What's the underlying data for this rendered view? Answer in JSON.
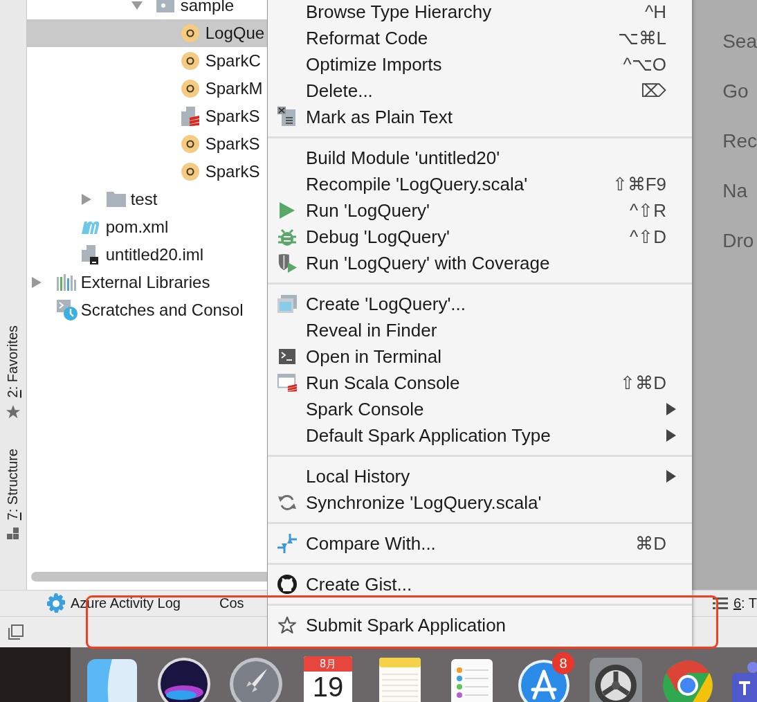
{
  "left_toolbar": [
    {
      "label": "2: Favorites",
      "kind": "favorites"
    },
    {
      "label": "7: Structure",
      "kind": "structure"
    }
  ],
  "project_tree": [
    {
      "children": [
        {
          "children": [
            {
              "children": [
                {
                  "children": [
                    {
                      "label": "sample",
                      "kind": "package",
                      "expanded": true,
                      "selected": false,
                      "children": [
                        {
                          "label": "LogQue",
                          "kind": "class",
                          "selected": true
                        },
                        {
                          "label": "SparkC",
                          "kind": "class",
                          "selected": false
                        },
                        {
                          "label": "SparkM",
                          "kind": "class",
                          "selected": false
                        },
                        {
                          "label": "SparkS",
                          "kind": "scala-script",
                          "selected": false
                        },
                        {
                          "label": "SparkS",
                          "kind": "class",
                          "selected": false
                        },
                        {
                          "label": "SparkS",
                          "kind": "class",
                          "selected": false
                        }
                      ]
                    }
                  ]
                }
              ]
            },
            {
              "label": "test",
              "kind": "folder",
              "expanded": false,
              "selected": false
            }
          ]
        },
        {
          "label": "pom.xml",
          "kind": "maven",
          "selected": false
        },
        {
          "label": "untitled20.iml",
          "kind": "module-file",
          "selected": false
        }
      ]
    },
    {
      "label": "External Libraries",
      "kind": "libraries",
      "expanded": false,
      "selected": false
    },
    {
      "label": "Scratches and Consol",
      "kind": "scratches",
      "selected": false
    }
  ],
  "editor_hints": [
    "Sea",
    "Go",
    "Rec",
    "Na",
    "Dro"
  ],
  "bottom_toolbar": {
    "left": [
      {
        "label": "Azure Activity Log",
        "kind": "azure"
      },
      {
        "label": "Cos",
        "kind": "plain"
      }
    ],
    "right": {
      "label": "6: T",
      "kind": "todo"
    }
  },
  "context_menu": [
    {
      "kind": "item",
      "label": "Browse Type Hierarchy",
      "shortcut": "^H",
      "submenu": false
    },
    {
      "kind": "item",
      "label": "Reformat Code",
      "shortcut": "⌥⌘L",
      "submenu": false
    },
    {
      "kind": "item",
      "label": "Optimize Imports",
      "shortcut": "^⌥O",
      "submenu": false
    },
    {
      "kind": "item",
      "label": "Delete...",
      "shortcut": "⌦",
      "submenu": false
    },
    {
      "kind": "item",
      "label": "Mark as Plain Text",
      "submenu": false
    },
    {
      "kind": "separator"
    },
    {
      "kind": "item",
      "label": "Build Module 'untitled20'",
      "submenu": false
    },
    {
      "kind": "item",
      "label": "Recompile 'LogQuery.scala'",
      "shortcut": "⇧⌘F9",
      "submenu": false
    },
    {
      "kind": "item",
      "label": "Run 'LogQuery'",
      "shortcut": "^⇧R",
      "submenu": false
    },
    {
      "kind": "item",
      "label": "Debug 'LogQuery'",
      "shortcut": "^⇧D",
      "submenu": false
    },
    {
      "kind": "item",
      "label": "Run 'LogQuery' with Coverage",
      "submenu": false
    },
    {
      "kind": "separator"
    },
    {
      "kind": "item",
      "label": "Create 'LogQuery'...",
      "submenu": false
    },
    {
      "kind": "item",
      "label": "Reveal in Finder",
      "submenu": false
    },
    {
      "kind": "item",
      "label": "Open in Terminal",
      "submenu": false
    },
    {
      "kind": "item",
      "label": "Run Scala Console",
      "shortcut": "⇧⌘D",
      "submenu": false
    },
    {
      "kind": "item",
      "label": "Spark Console",
      "submenu": true
    },
    {
      "kind": "item",
      "label": "Default Spark Application Type",
      "submenu": true
    },
    {
      "kind": "separator"
    },
    {
      "kind": "item",
      "label": "Local History",
      "submenu": true
    },
    {
      "kind": "item",
      "label": "Synchronize 'LogQuery.scala'",
      "submenu": false
    },
    {
      "kind": "separator"
    },
    {
      "kind": "item",
      "label": "Compare With...",
      "shortcut": "⌘D",
      "submenu": false
    },
    {
      "kind": "separator"
    },
    {
      "kind": "item",
      "label": "Create Gist...",
      "submenu": false
    },
    {
      "kind": "separator"
    },
    {
      "kind": "item",
      "label": "Submit Spark Application",
      "submenu": false
    }
  ],
  "dock": [
    {
      "kind": "finder"
    },
    {
      "kind": "siri"
    },
    {
      "kind": "launchpad"
    },
    {
      "kind": "calendar",
      "month": "8月",
      "day": "19"
    },
    {
      "kind": "notes"
    },
    {
      "kind": "reminders"
    },
    {
      "kind": "appstore",
      "badge": "8"
    },
    {
      "kind": "settings"
    },
    {
      "kind": "chrome"
    },
    {
      "kind": "teams"
    }
  ]
}
